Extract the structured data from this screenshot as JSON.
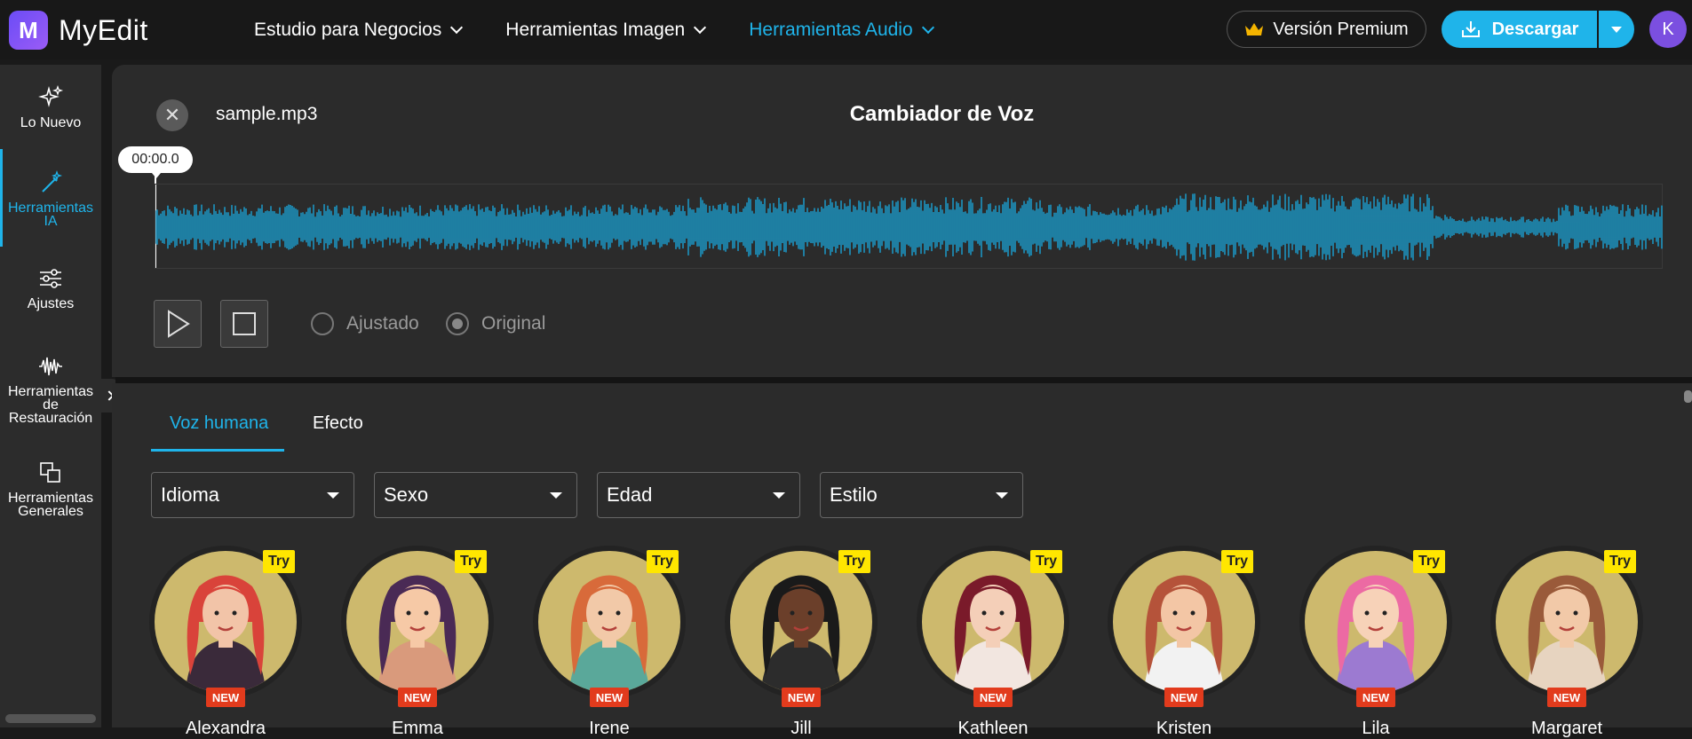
{
  "app": {
    "logo_letter": "M",
    "name": "MyEdit"
  },
  "nav": [
    {
      "label": "Estudio para Negocios",
      "active": false
    },
    {
      "label": "Herramientas Imagen",
      "active": false
    },
    {
      "label": "Herramientas Audio",
      "active": true
    }
  ],
  "header": {
    "premium_label": "Versión Premium",
    "download_label": "Descargar",
    "user_initial": "K"
  },
  "sidebar": {
    "items": [
      {
        "label": "Lo Nuevo",
        "icon": "sparkle-icon"
      },
      {
        "label": "Herramientas IA",
        "icon": "magic-wand-icon",
        "active": true
      },
      {
        "label": "Ajustes",
        "icon": "sliders-icon"
      },
      {
        "label": "Herramientas de Restauración",
        "icon": "waveform-icon"
      },
      {
        "label": "Herramientas Generales",
        "icon": "copy-icon"
      }
    ]
  },
  "player": {
    "filename": "sample.mp3",
    "title": "Cambiador de Voz",
    "timestamp": "00:00.0",
    "radio_adjusted": "Ajustado",
    "radio_original": "Original",
    "selected": "Original"
  },
  "tabs": [
    {
      "label": "Voz humana",
      "active": true
    },
    {
      "label": "Efecto",
      "active": false
    }
  ],
  "filters": [
    "Idioma",
    "Sexo",
    "Edad",
    "Estilo"
  ],
  "voices": {
    "try_label": "Try",
    "new_label": "NEW",
    "items": [
      {
        "name": "Alexandra",
        "hair": "#d9433a",
        "skin": "#f2c4a8",
        "shirt": "#3a2a3a"
      },
      {
        "name": "Emma",
        "hair": "#4a2a55",
        "skin": "#f6c9a6",
        "shirt": "#d99a7c"
      },
      {
        "name": "Irene",
        "hair": "#d86a3a",
        "skin": "#f2c9a8",
        "shirt": "#5aa89a"
      },
      {
        "name": "Jill",
        "hair": "#1a1a1a",
        "skin": "#6b3f2a",
        "shirt": "#2c2c2c"
      },
      {
        "name": "Kathleen",
        "hair": "#7a1a2a",
        "skin": "#f4cfb8",
        "shirt": "#f2e6e0"
      },
      {
        "name": "Kristen",
        "hair": "#b5533a",
        "skin": "#f3c6a5",
        "shirt": "#f2f2f2"
      },
      {
        "name": "Lila",
        "hair": "#ec6aa3",
        "skin": "#f7d2b8",
        "shirt": "#9c7ad1"
      },
      {
        "name": "Margaret",
        "hair": "#9a5a3a",
        "skin": "#f2c9a8",
        "shirt": "#e7d4c0"
      }
    ]
  },
  "colors": {
    "accent": "#1fb4ea",
    "waveform": "#1aa3d6",
    "new_badge": "#e23b1d",
    "try_badge": "#ffe600",
    "avatar_bg": "#cdb96d"
  }
}
